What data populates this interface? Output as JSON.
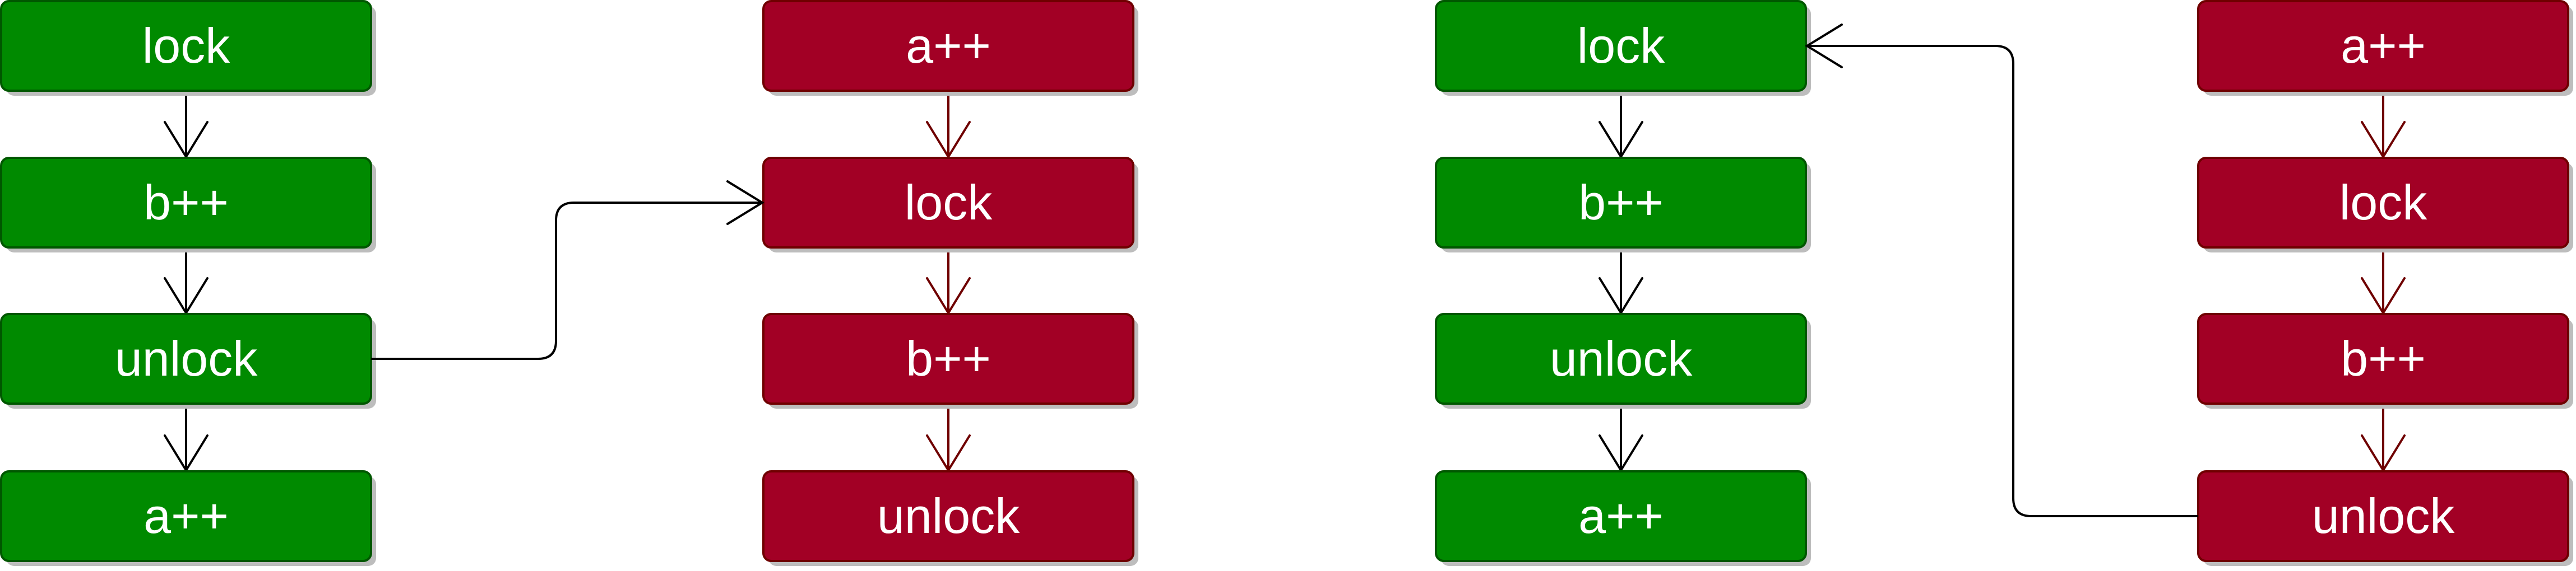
{
  "colors": {
    "green_fill": "#008a00",
    "green_border": "#005700",
    "red_fill": "#a20025",
    "red_border": "#6f0000",
    "black_edge": "#000000",
    "red_edge": "#6f0000",
    "shadow": "#bdbdbd",
    "background": "#ffffff"
  },
  "flows": [
    {
      "id": "flow-1",
      "color": "green",
      "steps": [
        "lock",
        "b++",
        "unlock",
        "a++"
      ]
    },
    {
      "id": "flow-2",
      "color": "red",
      "steps": [
        "a++",
        "lock",
        "b++",
        "unlock"
      ]
    },
    {
      "id": "flow-3",
      "color": "green",
      "steps": [
        "lock",
        "b++",
        "unlock",
        "a++"
      ]
    },
    {
      "id": "flow-4",
      "color": "red",
      "steps": [
        "a++",
        "lock",
        "b++",
        "unlock"
      ]
    }
  ],
  "connectors": [
    {
      "from": "flow-1.2",
      "to": "flow-2.1"
    },
    {
      "from": "flow-4.3",
      "to": "flow-3.0"
    }
  ]
}
